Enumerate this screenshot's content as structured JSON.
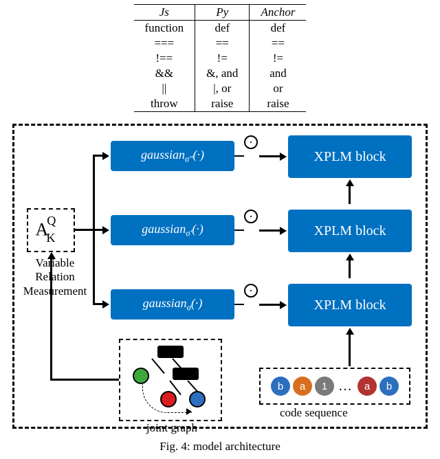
{
  "table": {
    "headers": [
      "Js",
      "Py",
      "Anchor"
    ],
    "rows": [
      [
        "function",
        "def",
        "def"
      ],
      [
        "===",
        "==",
        "=="
      ],
      [
        "!==",
        "!=",
        "!="
      ],
      [
        "&&",
        "&, and",
        "and"
      ],
      [
        "||",
        "|, or",
        "or"
      ],
      [
        "throw",
        "raise",
        "raise"
      ]
    ]
  },
  "diagram": {
    "ak": {
      "base": "A",
      "sub": "K",
      "sup": "Q"
    },
    "ak_label_l1": "Variable",
    "ak_label_l2": "Relation",
    "ak_label_l3": "Measurement",
    "gaussian_prefix": "gaussian",
    "gaussian_subs": [
      "σ″",
      "σ′",
      "σ"
    ],
    "gaussian_arg": "(·)",
    "xplm_label": "XPLM block",
    "joint_graph_label": "joint graph",
    "code_seq_label": "code sequence",
    "tokens": [
      {
        "t": "b",
        "c": "#2d6fbf"
      },
      {
        "t": "a",
        "c": "#d96f1e"
      },
      {
        "t": "1",
        "c": "#7a7a7a"
      },
      {
        "t": "a",
        "c": "#b33232"
      },
      {
        "t": "b",
        "c": "#2d6fbf"
      }
    ],
    "graph_nodes": {
      "green": "#3da93d",
      "red": "#d91e1e",
      "blue": "#2d6fbf"
    }
  },
  "caption": "Fig. 4: model architecture"
}
